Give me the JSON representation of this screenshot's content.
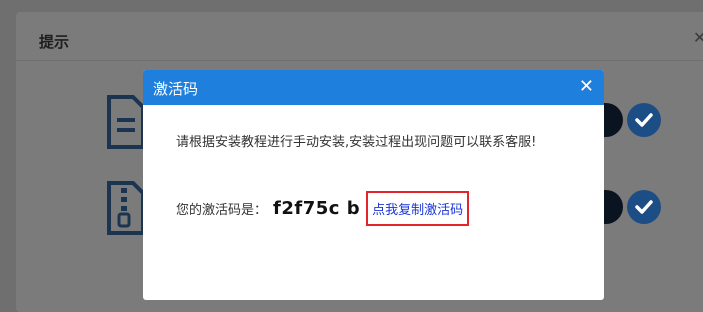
{
  "background_dialog": {
    "title": "提示",
    "close_icon": "close-icon"
  },
  "modal": {
    "title": "激活码",
    "close_icon": "close-icon",
    "message": "请根据安装教程进行手动安装,安装过程出现问题可以联系客服!",
    "code_label": "您的激活码是：",
    "code_value": "f2f75c  b",
    "copy_link": "点我复制激活码"
  },
  "colors": {
    "header": "#1f7fdc",
    "link": "#1a35d8",
    "highlight_border": "#e3262b"
  }
}
